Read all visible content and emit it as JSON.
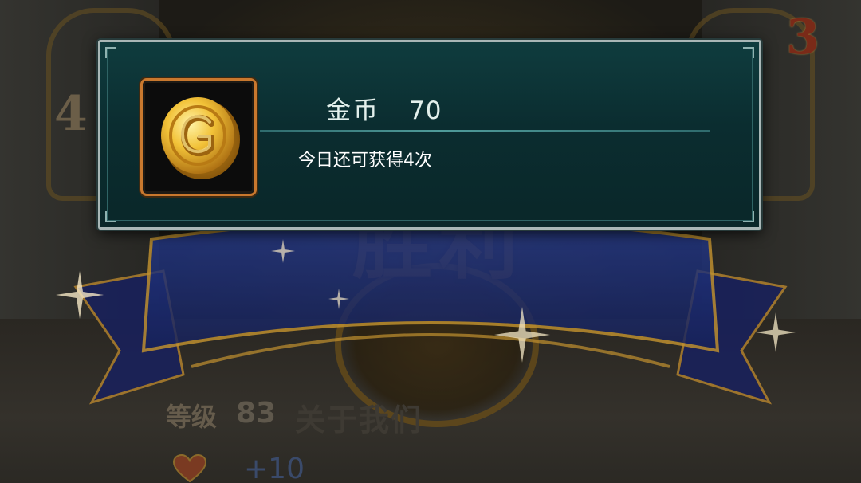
{
  "background": {
    "left_number": "4",
    "right_number": "3",
    "victory_text": "胜利"
  },
  "popup": {
    "item_name": "金币",
    "item_count": "70",
    "remaining_text": "今日还可获得4次",
    "item_icon": "gold-coin-icon"
  },
  "stats": {
    "level_label": "等级",
    "level_value": "83",
    "about_label": "关于我们",
    "bonus_value": "+10",
    "bonus_icon": "heart-icon"
  },
  "colors": {
    "panel": "#0d3436",
    "panel_border": "#a9b7b6",
    "slot_border": "#c8782e",
    "ribbon": "#1c2a6e",
    "gold": "#d8a227"
  }
}
